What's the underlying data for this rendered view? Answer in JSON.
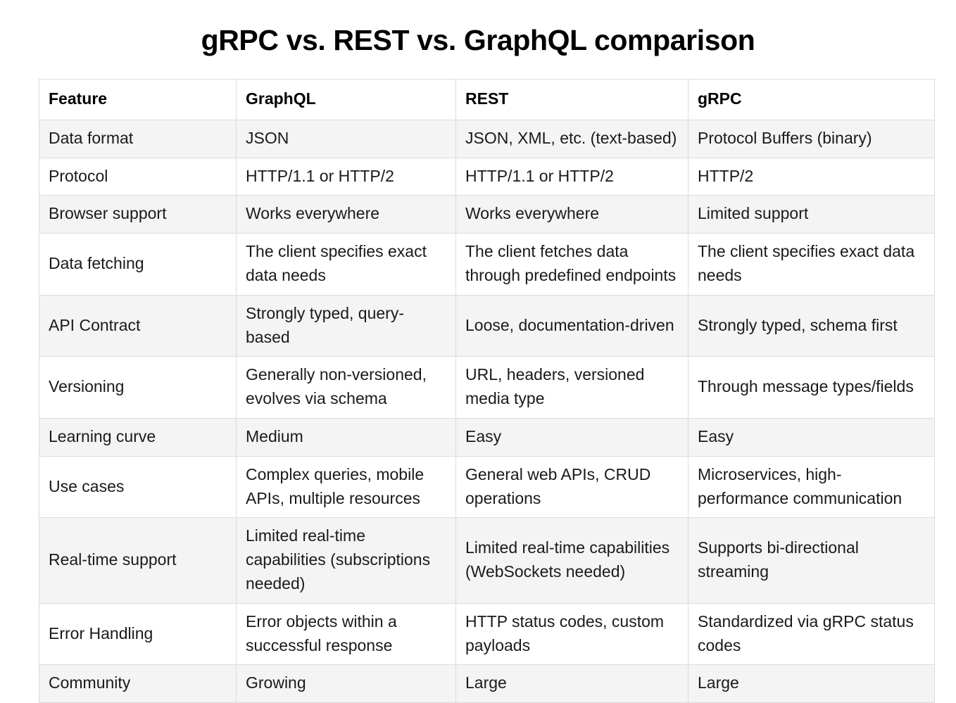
{
  "page": {
    "title": "gRPC vs. REST vs. GraphQL comparison",
    "background_color": "#ffffff",
    "text_color": "#1a1a1a",
    "shaded_row_color": "#f4f4f4",
    "border_color": "#dcdcdc"
  },
  "table": {
    "columns": [
      "Feature",
      "GraphQL",
      "REST",
      "gRPC"
    ],
    "rows": [
      {
        "shaded": true,
        "cells": [
          "Data format",
          "JSON",
          "JSON, XML, etc. (text-based)",
          "Protocol Buffers (binary)"
        ]
      },
      {
        "shaded": false,
        "cells": [
          "Protocol",
          "HTTP/1.1 or HTTP/2",
          "HTTP/1.1 or HTTP/2",
          "HTTP/2"
        ]
      },
      {
        "shaded": true,
        "cells": [
          "Browser support",
          "Works everywhere",
          "Works everywhere",
          "Limited support"
        ]
      },
      {
        "shaded": false,
        "cells": [
          "Data fetching",
          "The client specifies exact data needs",
          "The client fetches data through predefined endpoints",
          "The client specifies exact data needs"
        ]
      },
      {
        "shaded": true,
        "cells": [
          "API Contract",
          "Strongly typed, query-based",
          "Loose, documentation-driven",
          "Strongly typed, schema first"
        ]
      },
      {
        "shaded": false,
        "cells": [
          "Versioning",
          "Generally non-versioned, evolves via schema",
          "URL, headers, versioned media type",
          "Through message types/fields"
        ]
      },
      {
        "shaded": true,
        "cells": [
          "Learning curve",
          "Medium",
          "Easy",
          "Easy"
        ]
      },
      {
        "shaded": false,
        "cells": [
          "Use cases",
          "Complex queries, mobile APIs, multiple resources",
          "General web APIs, CRUD operations",
          "Microservices, high-performance communication"
        ]
      },
      {
        "shaded": true,
        "cells": [
          "Real-time support",
          "Limited real-time capabilities (subscriptions needed)",
          "Limited real-time capabilities (WebSockets needed)",
          "Supports bi-directional streaming"
        ]
      },
      {
        "shaded": false,
        "cells": [
          "Error Handling",
          "Error objects within a successful response",
          "HTTP status codes, custom payloads",
          "Standardized via gRPC status codes"
        ]
      },
      {
        "shaded": true,
        "cells": [
          "Community",
          "Growing",
          "Large",
          "Large"
        ]
      }
    ]
  }
}
